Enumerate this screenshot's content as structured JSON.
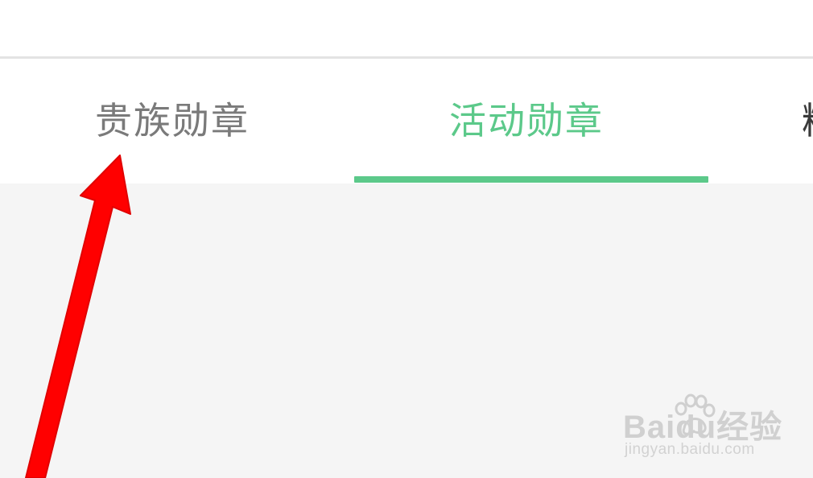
{
  "tabs": [
    {
      "label": "贵族勋章",
      "state": "inactive"
    },
    {
      "label": "活动勋章",
      "state": "active"
    },
    {
      "label": "精",
      "state": "inactive"
    }
  ],
  "colors": {
    "active_tab": "#5cc98a",
    "inactive_tab": "#7a7a7a",
    "content_background": "#f5f5f5",
    "annotation_arrow": "#ff0000"
  },
  "watermark": {
    "logo_text": "Baidu经验",
    "url": "jingyan.baidu.com"
  },
  "annotation": {
    "icon": "red-arrow-pointing-up",
    "target": "tab 1"
  }
}
